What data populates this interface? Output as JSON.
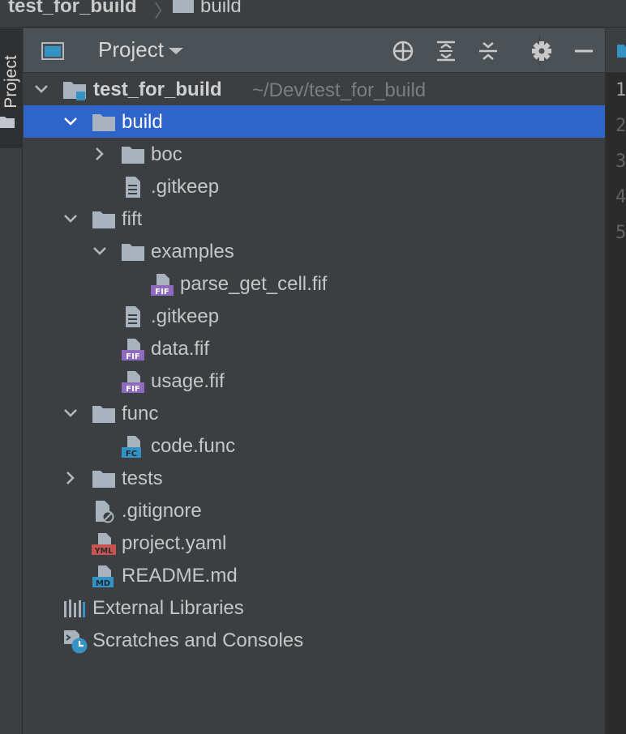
{
  "breadcrumb": {
    "root": "test_for_build",
    "separator": "〉",
    "current": "build"
  },
  "sidebar_tab": {
    "label": "Project"
  },
  "panel": {
    "title": "Project",
    "actions": [
      "crosshair-icon",
      "expand-all-icon",
      "collapse-all-icon",
      "gear-icon",
      "minimize-icon"
    ]
  },
  "tree": {
    "project_name": "test_for_build",
    "project_path": "~/Dev/test_for_build",
    "items": [
      {
        "label": "build",
        "type": "folder",
        "expanded": true,
        "selected": true
      },
      {
        "label": "boc",
        "type": "folder",
        "expanded": false
      },
      {
        "label": ".gitkeep",
        "type": "text-file"
      },
      {
        "label": "fift",
        "type": "folder",
        "expanded": true
      },
      {
        "label": "examples",
        "type": "folder",
        "expanded": true
      },
      {
        "label": "parse_get_cell.fif",
        "type": "fif-file",
        "badge": "FIF"
      },
      {
        "label": ".gitkeep",
        "type": "text-file"
      },
      {
        "label": "data.fif",
        "type": "fif-file",
        "badge": "FIF"
      },
      {
        "label": "usage.fif",
        "type": "fif-file",
        "badge": "FIF"
      },
      {
        "label": "func",
        "type": "folder",
        "expanded": true
      },
      {
        "label": "code.func",
        "type": "func-file",
        "badge": "FC"
      },
      {
        "label": "tests",
        "type": "folder",
        "expanded": false
      },
      {
        "label": ".gitignore",
        "type": "ignore-file"
      },
      {
        "label": "project.yaml",
        "type": "yaml-file",
        "badge": "YML"
      },
      {
        "label": "README.md",
        "type": "md-file",
        "badge": "MD"
      },
      {
        "label": "External Libraries",
        "type": "libraries"
      },
      {
        "label": "Scratches and Consoles",
        "type": "scratches"
      }
    ]
  },
  "editor": {
    "line_numbers": [
      "1",
      "2",
      "3",
      "4",
      "5"
    ]
  },
  "colors": {
    "selection": "#2f65ca",
    "fif_badge": "#8e6bbf",
    "func_badge": "#3592c4",
    "yaml_badge": "#c75450",
    "md_badge": "#3592c4",
    "folder": "#a9b3bd"
  }
}
